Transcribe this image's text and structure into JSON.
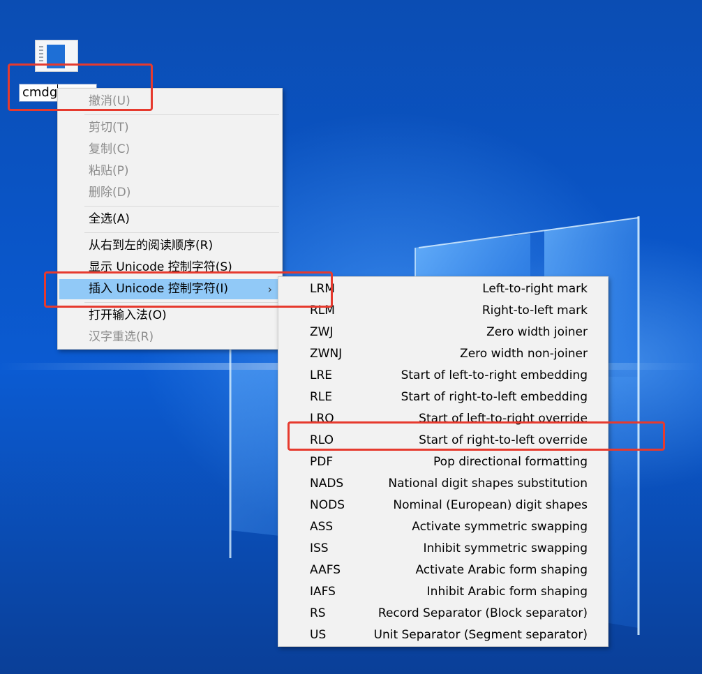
{
  "desktop": {
    "icon_name": "document-file-icon",
    "rename_value": "cmdg"
  },
  "context_menu": {
    "items": [
      {
        "label": "撤消(U)",
        "enabled": false
      },
      {
        "label": "剪切(T)",
        "enabled": false
      },
      {
        "label": "复制(C)",
        "enabled": false
      },
      {
        "label": "粘贴(P)",
        "enabled": false
      },
      {
        "label": "删除(D)",
        "enabled": false
      },
      {
        "label": "全选(A)",
        "enabled": true
      },
      {
        "label": "从右到左的阅读顺序(R)",
        "enabled": true
      },
      {
        "label": "显示 Unicode 控制字符(S)",
        "enabled": true
      },
      {
        "label": "插入 Unicode 控制字符(I)",
        "enabled": true,
        "highlighted": true,
        "submenu_arrow": "›"
      },
      {
        "label": "打开输入法(O)",
        "enabled": true
      },
      {
        "label": "汉字重选(R)",
        "enabled": false
      }
    ]
  },
  "unicode_submenu": {
    "items": [
      {
        "code": "LRM",
        "description": "Left-to-right mark"
      },
      {
        "code": "RLM",
        "description": "Right-to-left mark"
      },
      {
        "code": "ZWJ",
        "description": "Zero width joiner"
      },
      {
        "code": "ZWNJ",
        "description": "Zero width non-joiner"
      },
      {
        "code": "LRE",
        "description": "Start of left-to-right embedding"
      },
      {
        "code": "RLE",
        "description": "Start of right-to-left embedding"
      },
      {
        "code": "LRO",
        "description": "Start of left-to-right override"
      },
      {
        "code": "RLO",
        "description": "Start of right-to-left override"
      },
      {
        "code": "PDF",
        "description": "Pop directional formatting"
      },
      {
        "code": "NADS",
        "description": "National digit shapes substitution"
      },
      {
        "code": "NODS",
        "description": "Nominal (European) digit shapes"
      },
      {
        "code": "ASS",
        "description": "Activate symmetric swapping"
      },
      {
        "code": "ISS",
        "description": "Inhibit symmetric swapping"
      },
      {
        "code": "AAFS",
        "description": "Activate Arabic form shaping"
      },
      {
        "code": "IAFS",
        "description": "Inhibit Arabic form shaping"
      },
      {
        "code": "RS",
        "description": "Record Separator (Block separator)"
      },
      {
        "code": "US",
        "description": "Unit Separator (Segment separator)"
      }
    ]
  },
  "colors": {
    "annotation_red": "#e63a2e",
    "menu_highlight": "#91c9f7",
    "menu_background": "#f2f2f2",
    "wallpaper_blue": "#0b5bd2"
  }
}
